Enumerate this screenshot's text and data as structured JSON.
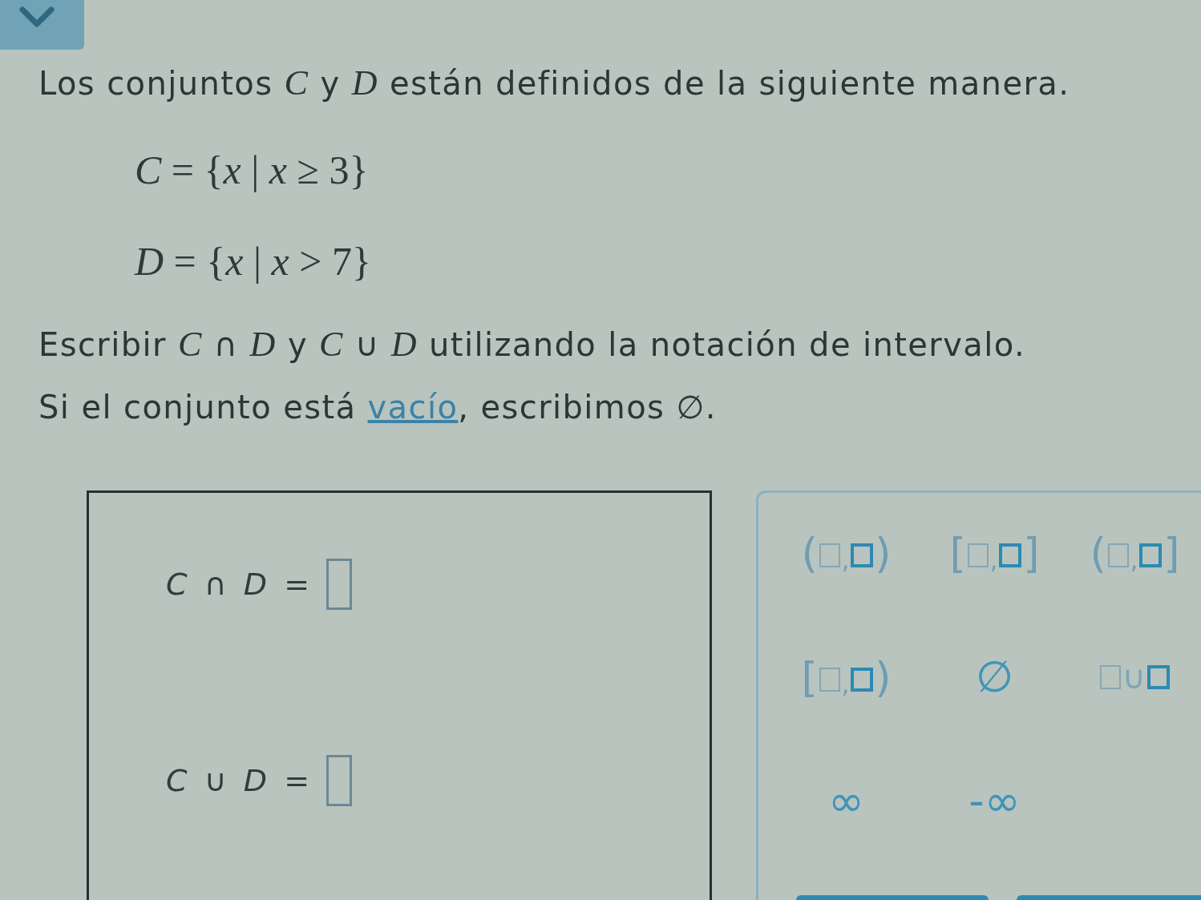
{
  "intro": "Los conjuntos *C* y *D* están definidos de la siguiente manera.",
  "definitions": [
    "*C* = {*x* | *x* ≥ 3}",
    "*D* = {*x* | *x* > 7}"
  ],
  "instruction": "Escribir *C* ∩ *D* y *C* ∪ *D* utilizando la notación de intervalo.",
  "empty_set_note": {
    "before": "Si el conjunto está ",
    "link": "vacío",
    "after": ", escribimos ∅."
  },
  "answers": [
    {
      "expression": "*C* ∩ *D* ="
    },
    {
      "expression": "*C* ∪ *D* ="
    }
  ],
  "keypad": {
    "keys": [
      {
        "kind": "interval",
        "left": "(",
        "separator": ",",
        "right": ")"
      },
      {
        "kind": "interval",
        "left": "[",
        "separator": ",",
        "right": "]"
      },
      {
        "kind": "interval",
        "left": "(",
        "separator": ",",
        "right": "]"
      },
      {
        "kind": "interval",
        "left": "[",
        "separator": ",",
        "right": ")"
      },
      {
        "kind": "symbol",
        "label": "∅"
      },
      {
        "kind": "union",
        "operator": "∪"
      },
      {
        "kind": "symbol",
        "label": "∞"
      },
      {
        "kind": "symbol",
        "label": "-∞"
      }
    ]
  }
}
